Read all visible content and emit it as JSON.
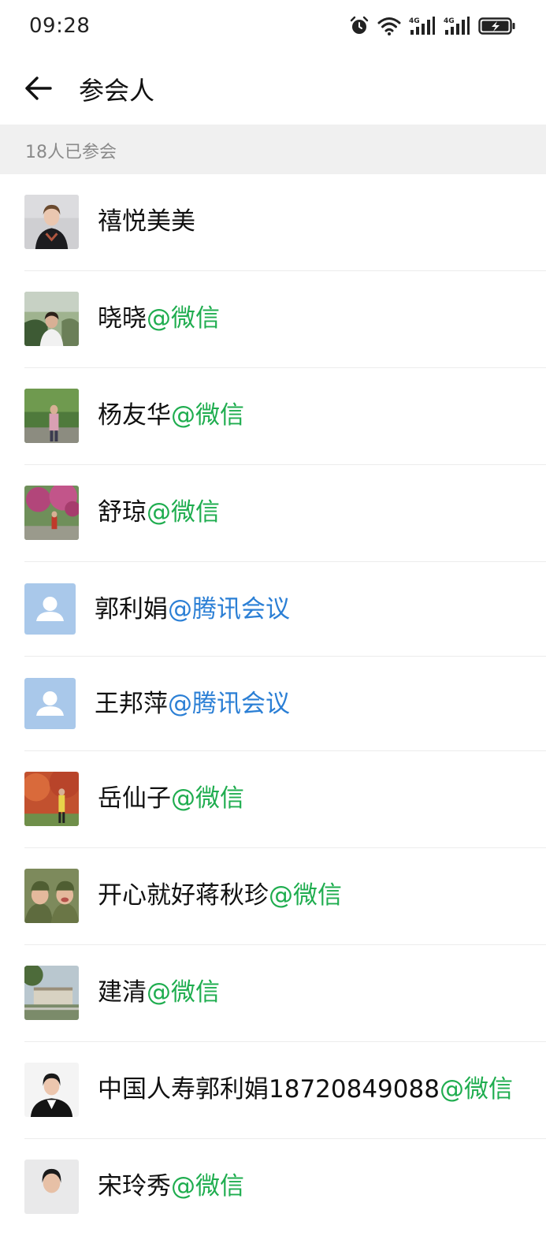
{
  "status_bar": {
    "time": "09:28",
    "icons": [
      "alarm-icon",
      "wifi-icon",
      "signal-4g-icon",
      "signal-4g-icon",
      "battery-charging-icon"
    ]
  },
  "header": {
    "title": "参会人"
  },
  "section": {
    "count_label": "18人已参会"
  },
  "colors": {
    "wechat_suffix": "#1fad4f",
    "tencent_suffix": "#2b7fd5",
    "section_bg": "#f0f0f0"
  },
  "participants": [
    {
      "name": "禧悦美美",
      "suffix": "",
      "avatar": "photo"
    },
    {
      "name": "晓晓",
      "suffix": "@微信",
      "avatar": "photo"
    },
    {
      "name": "杨友华",
      "suffix": "@微信",
      "avatar": "photo"
    },
    {
      "name": "舒琼",
      "suffix": "@微信",
      "avatar": "photo"
    },
    {
      "name": "郭利娟",
      "suffix": "@腾讯会议",
      "avatar": "default-user-icon"
    },
    {
      "name": "王邦萍",
      "suffix": "@腾讯会议",
      "avatar": "default-user-icon"
    },
    {
      "name": "岳仙子",
      "suffix": "@微信",
      "avatar": "photo"
    },
    {
      "name": "开心就好蒋秋珍",
      "suffix": "@微信",
      "avatar": "photo"
    },
    {
      "name": "建清",
      "suffix": "@微信",
      "avatar": "photo"
    },
    {
      "name": "中国人寿郭利娟18720849088",
      "suffix": "@微信",
      "avatar": "photo"
    },
    {
      "name": "宋玲秀",
      "suffix": "@微信",
      "avatar": "photo"
    }
  ]
}
